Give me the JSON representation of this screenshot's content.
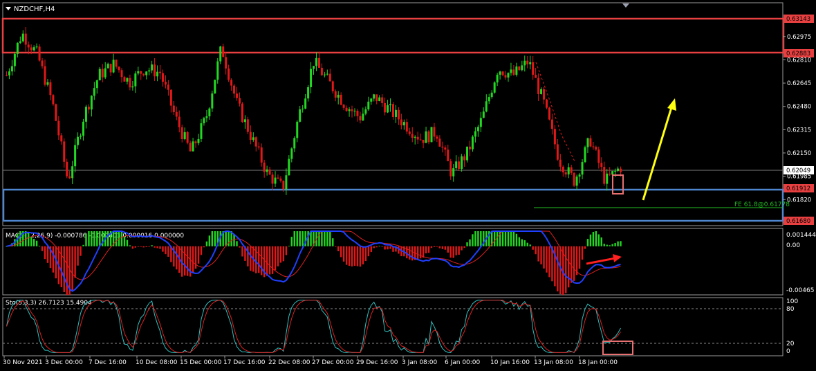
{
  "symbol_label": "NZDCHF,H4",
  "colors": {
    "bull": "#22d822",
    "bear": "#e01818",
    "grid": "#404040",
    "frame": "#9a9a9a",
    "zone_red": "#e84040",
    "zone_blue": "#4f86d0",
    "arrow_yellow": "#ffff10",
    "arrow_red": "#ff2020",
    "macd_line": "#2040ff",
    "signal_line": "#e02020",
    "fib": "#22c022"
  },
  "price_scale": [
    "0.62975",
    "0.62810",
    "0.62645",
    "0.62480",
    "0.62315",
    "0.62150",
    "0.61985",
    "0.61820",
    "0.61655"
  ],
  "price_markers": {
    "top_zone_high": "0.63143",
    "top_zone_low": "0.62883",
    "current": "0.62049",
    "last_red": "0.61912",
    "bottom_zone_low": "0.61680"
  },
  "fib_label": "FE 61.8@0.61778",
  "macd_label": "MACD(12,26,9) -0.000786 -0.000803 0.000016 0.000000",
  "macd_scale": [
    "0.001444",
    "0.00",
    "-0.00465"
  ],
  "sto_label": "Sto(5,3,3) 26.7123 15.4904",
  "sto_scale": [
    "100",
    "80",
    "20",
    "0"
  ],
  "time_axis": [
    "30 Nov 2021",
    "3 Dec 00:00",
    "7 Dec 16:00",
    "10 Dec 08:00",
    "15 Dec 00:00",
    "17 Dec 16:00",
    "22 Dec 08:00",
    "27 Dec 00:00",
    "29 Dec 16:00",
    "3 Jan 08:00",
    "6 Jan 00:00",
    "10 Jan 16:00",
    "13 Jan 08:00",
    "18 Jan 00:00"
  ],
  "chart_data": {
    "type": "candlestick",
    "title": "NZDCHF,H4",
    "ylim": [
      0.6163,
      0.6317
    ],
    "price_path": [
      [
        "30 Nov 2021",
        0.627
      ],
      [
        "",
        0.63
      ],
      [
        "",
        0.6285
      ],
      [
        "",
        0.625
      ],
      [
        "3 Dec 00:00",
        0.6195
      ],
      [
        "",
        0.624
      ],
      [
        "",
        0.627
      ],
      [
        "7 Dec 16:00",
        0.6278
      ],
      [
        "",
        0.6265
      ],
      [
        "",
        0.6275
      ],
      [
        "10 Dec 08:00",
        0.6272
      ],
      [
        "",
        0.624
      ],
      [
        "",
        0.6215
      ],
      [
        "",
        0.624
      ],
      [
        "15 Dec 00:00",
        0.629
      ],
      [
        "",
        0.625
      ],
      [
        "",
        0.6225
      ],
      [
        "17 Dec 16:00",
        0.62
      ],
      [
        "",
        0.619
      ],
      [
        "",
        0.624
      ],
      [
        "22 Dec 08:00",
        0.628
      ],
      [
        "",
        0.6265
      ],
      [
        "27 Dec 00:00",
        0.625
      ],
      [
        "",
        0.624
      ],
      [
        "",
        0.6255
      ],
      [
        "29 Dec 16:00",
        0.6245
      ],
      [
        "",
        0.6235
      ],
      [
        "3 Jan 08:00",
        0.6225
      ],
      [
        "",
        0.623
      ],
      [
        "6 Jan 00:00",
        0.62
      ],
      [
        "",
        0.6215
      ],
      [
        "",
        0.624
      ],
      [
        "10 Jan 16:00",
        0.6275
      ],
      [
        "",
        0.627
      ],
      [
        "13 Jan 08:00",
        0.628
      ],
      [
        "",
        0.625
      ],
      [
        "",
        0.621
      ],
      [
        "18 Jan 00:00",
        0.6195
      ],
      [
        "",
        0.6225
      ],
      [
        "",
        0.6195
      ],
      [
        "",
        0.6205
      ]
    ],
    "zones": [
      {
        "name": "resistance",
        "low": 0.62883,
        "high": 0.63143
      },
      {
        "name": "support",
        "low": 0.6168,
        "high": 0.61912
      }
    ],
    "fib_level": 0.61778,
    "macd": {
      "ylim": [
        -0.00465,
        0.001444
      ],
      "levels": [
        0.001444,
        0.0,
        -0.00465
      ]
    },
    "stochastic": {
      "ylim": [
        0,
        100
      ],
      "levels": [
        80,
        20
      ]
    }
  }
}
